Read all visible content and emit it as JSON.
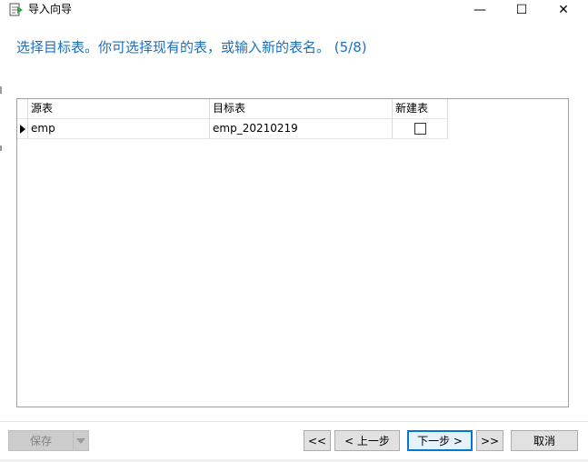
{
  "window": {
    "title": "导入向导",
    "minimize_glyph": "—",
    "maximize_glyph": "☐",
    "close_glyph": "✕"
  },
  "header": {
    "instruction": "选择目标表。你可选择现有的表，或输入新的表名。 (5/8)"
  },
  "grid": {
    "columns": [
      "源表",
      "目标表",
      "新建表"
    ],
    "rows": [
      {
        "source": "emp",
        "target": "emp_20210219",
        "new_table": false
      }
    ]
  },
  "footer": {
    "save_label": "保存",
    "first_label": "<<",
    "prev_label": "< 上一步",
    "next_label": "下一步 >",
    "last_label": ">>",
    "cancel_label": "取消"
  },
  "colors": {
    "accent": "#1c6fbe",
    "focus_border": "#0078d7"
  },
  "icons": [
    "app-icon",
    "minimize-icon",
    "maximize-icon",
    "close-icon",
    "row-pointer-icon",
    "dropdown-arrow-icon"
  ]
}
